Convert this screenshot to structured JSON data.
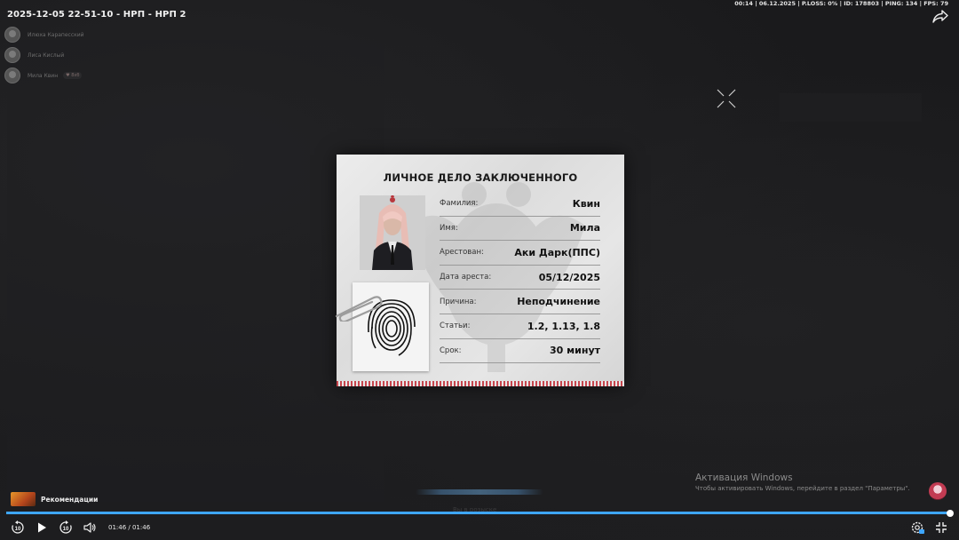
{
  "video": {
    "title": "2025-12-05 22-51-10 - НРП - НРП 2",
    "time_display": "01:46 / 01:46",
    "progress_percent": 100
  },
  "hud": {
    "stats": "00:14 | 06.12.2025 | P.LOSS: 0% | ID: 178803 | PING: 134 | FPS: 79"
  },
  "players": [
    {
      "name": "Илюха Карапесский",
      "badge": ""
    },
    {
      "name": "Лиса Кислый",
      "badge": ""
    },
    {
      "name": "Мила Квин",
      "badge": "♥ 8хб"
    }
  ],
  "card": {
    "title": "ЛИЧНОЕ ДЕЛО ЗАКЛЮЧЕННОГО",
    "fields": [
      {
        "label": "Фамилия:",
        "value": "Квин"
      },
      {
        "label": "Имя:",
        "value": "Мила"
      },
      {
        "label": "Арестован:",
        "value": "Аки Дарк(ППС)"
      },
      {
        "label": "Дата ареста:",
        "value": "05/12/2025"
      },
      {
        "label": "Причина:",
        "value": "Неподчинение"
      },
      {
        "label": "Статьи:",
        "value": "1.2, 1.13, 1.8"
      },
      {
        "label": "Срок:",
        "value": "30 минут"
      }
    ]
  },
  "faded_text": "Вы в розыске",
  "watermark": {
    "title": "Активация Windows",
    "subtitle": "Чтобы активировать Windows, перейдите в раздел \"Параметры\"."
  },
  "recommendations": {
    "label": "Рекомендации"
  },
  "colors": {
    "accent": "#3ea6ff",
    "card_stripe": "#c6454d"
  },
  "icons": [
    "share-icon",
    "rewind-10-icon",
    "play-icon",
    "forward-10-icon",
    "volume-icon",
    "settings-icon",
    "fullscreen-exit-icon",
    "crosshair-icon",
    "fingerprint-icon",
    "paperclip-icon"
  ]
}
